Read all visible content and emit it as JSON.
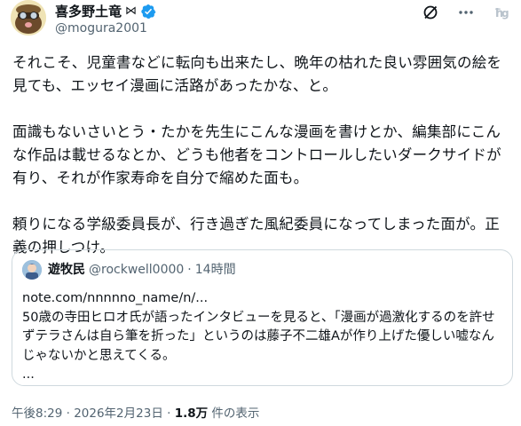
{
  "post": {
    "author_name": "喜多野土竜",
    "author_handle": "@mogura2001",
    "text": "それこそ、児童書などに転向も出来たし、晩年の枯れた良い雰囲気の絵を見ても、エッセイ漫画に活路があったかな、と。\n\n面識もないさいとう・たかを先生にこんな漫画を書けとか、編集部にこんな作品は載せるなとか、どうも他者をコントロールしたいダークサイドが有り、それが作家寿命を自分で縮めた面も。\n\n頼りになる学級委員長が、行き過ぎた風紀委員になってしまった面が。正義の押しつけ。"
  },
  "quote": {
    "name": "遊牧民",
    "handle": "@rockwell0000",
    "separator": "·",
    "time": "14時間",
    "body": "note.com/nnnnno_name/n/...\n50歳の寺田ヒロオ氏が語ったインタビューを見ると、「漫画が過激化するのを許せずテラさんは自ら筆を折った」というのは藤子不二雄Aが作り上げた優しい嘘なんじゃないかと思えてくる。\n..."
  },
  "meta": {
    "time": "午後8:29",
    "separator": " · ",
    "date": "2026年2月23日",
    "views_count": "1.8万",
    "views_label": " 件の表示"
  },
  "colors": {
    "verified": "#1d9bf0",
    "secondary_text": "#536471",
    "border": "#cfd9de"
  },
  "icons": [
    "bowtie-icon",
    "verified-badge-icon",
    "grok-icon",
    "more-icon",
    "bookmark-extension-icon"
  ]
}
